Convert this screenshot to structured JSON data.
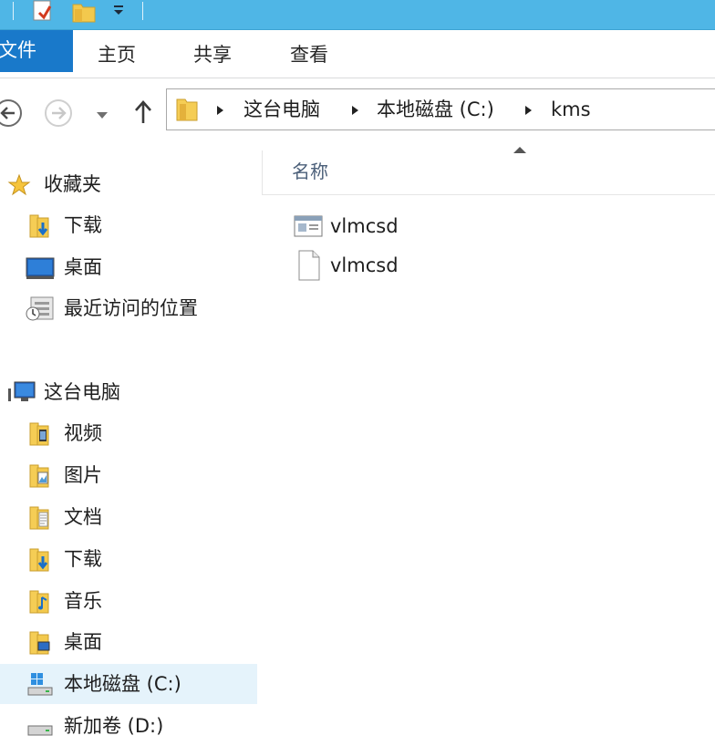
{
  "window": {
    "qat": [
      "properties-icon",
      "new-folder-icon",
      "customize-dropdown-icon"
    ]
  },
  "ribbon": {
    "file_tab": "文件",
    "tabs": [
      "主页",
      "共享",
      "查看"
    ]
  },
  "navigation": {
    "back": "back-arrow-icon",
    "forward": "forward-arrow-icon",
    "recent": "recent-locations-dropdown-icon",
    "up": "up-arrow-icon"
  },
  "address": {
    "crumbs": [
      "这台电脑",
      "本地磁盘 (C:)",
      "kms"
    ]
  },
  "navpane": {
    "favorites": {
      "label": "收藏夹",
      "items": [
        "下载",
        "桌面",
        "最近访问的位置"
      ]
    },
    "thispc": {
      "label": "这台电脑",
      "items": [
        "视频",
        "图片",
        "文档",
        "下载",
        "音乐",
        "桌面",
        "本地磁盘 (C:)",
        "新加卷 (D:)"
      ],
      "selected_index": 6
    }
  },
  "content": {
    "column_header": "名称",
    "files": [
      {
        "name": "vlmcsd",
        "icon": "executable-window-icon"
      },
      {
        "name": "vlmcsd",
        "icon": "blank-document-icon"
      }
    ]
  },
  "colors": {
    "titlebar": "#4fb6e6",
    "file_tab": "#1979ca",
    "selection": "#e5f3fb"
  }
}
